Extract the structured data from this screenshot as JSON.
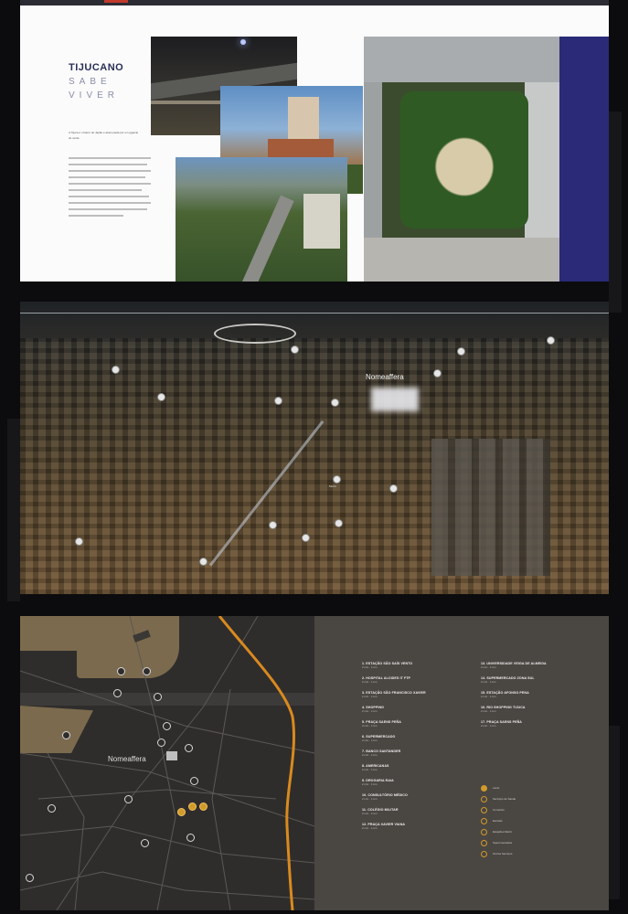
{
  "brochure": {
    "brand_line1": "TIJUCANO",
    "brand_line2": "SABE",
    "brand_line3": "VIVER",
    "lead_text": "A Tijuca é o bairro do Japão e abençoada por um gigante do verde"
  },
  "aerial": {
    "building_label": "Nomeaffera",
    "pin_tag": "Metrô"
  },
  "map": {
    "area_label": "Nomeaffera",
    "legend_left": [
      {
        "title": "1. ESTAÇÃO SÃO SAÍS VENTO",
        "sub": "2 min   ·   1 km"
      },
      {
        "title": "2. HOSPITAL ALCIDES IT FTP",
        "sub": "2 min   ·   1 km"
      },
      {
        "title": "3. ESTAÇÃO SÃO FRANCISCO XAVIER",
        "sub": "2 min   ·   1 km"
      },
      {
        "title": "4. SHOPPING",
        "sub": "2 min   ·   1 km"
      },
      {
        "title": "5. PRAÇA SAENS PEÑA",
        "sub": "2 min   ·   1 km"
      },
      {
        "title": "6. SUPERMERCADO",
        "sub": "2 min   ·   1 km"
      },
      {
        "title": "7. BANCO SANTANDER",
        "sub": "2 min   ·   1 km"
      },
      {
        "title": "8. AMERICANAS",
        "sub": "2 min   ·   1 km"
      },
      {
        "title": "9. DROGARIA RAIA",
        "sub": "2 min   ·   1 km"
      },
      {
        "title": "10. CONSULTÓRIO MÉDICO",
        "sub": "2 min   ·   1 km"
      },
      {
        "title": "11. COLÉGIO MILITAR",
        "sub": "2 min   ·   1 km"
      },
      {
        "title": "12. PRAÇA XAVIER VIANA",
        "sub": "2 min   ·   1 km"
      }
    ],
    "legend_right": [
      {
        "title": "13. UNIVERSIDADE VEIGA DE ALMEIDA",
        "sub": "2 min   ·   1 km"
      },
      {
        "title": "14. SUPERMERCADO ZONA SUL",
        "sub": "2 min   ·   1 km"
      },
      {
        "title": "15. ESTAÇÃO AFONSO PENA",
        "sub": "2 min   ·   1 km"
      },
      {
        "title": "16. RIO SHOPPING TIJUCA",
        "sub": "2 min   ·   1 km"
      },
      {
        "title": "17. PRAÇA SAENS PEÑA",
        "sub": "2 min   ·   1 km"
      }
    ],
    "key": [
      "Lazer",
      "Serviços de Saúde",
      "Comércio",
      "Escolas",
      "Estações Metrô",
      "Supermercados",
      "Outros Serviços"
    ]
  }
}
